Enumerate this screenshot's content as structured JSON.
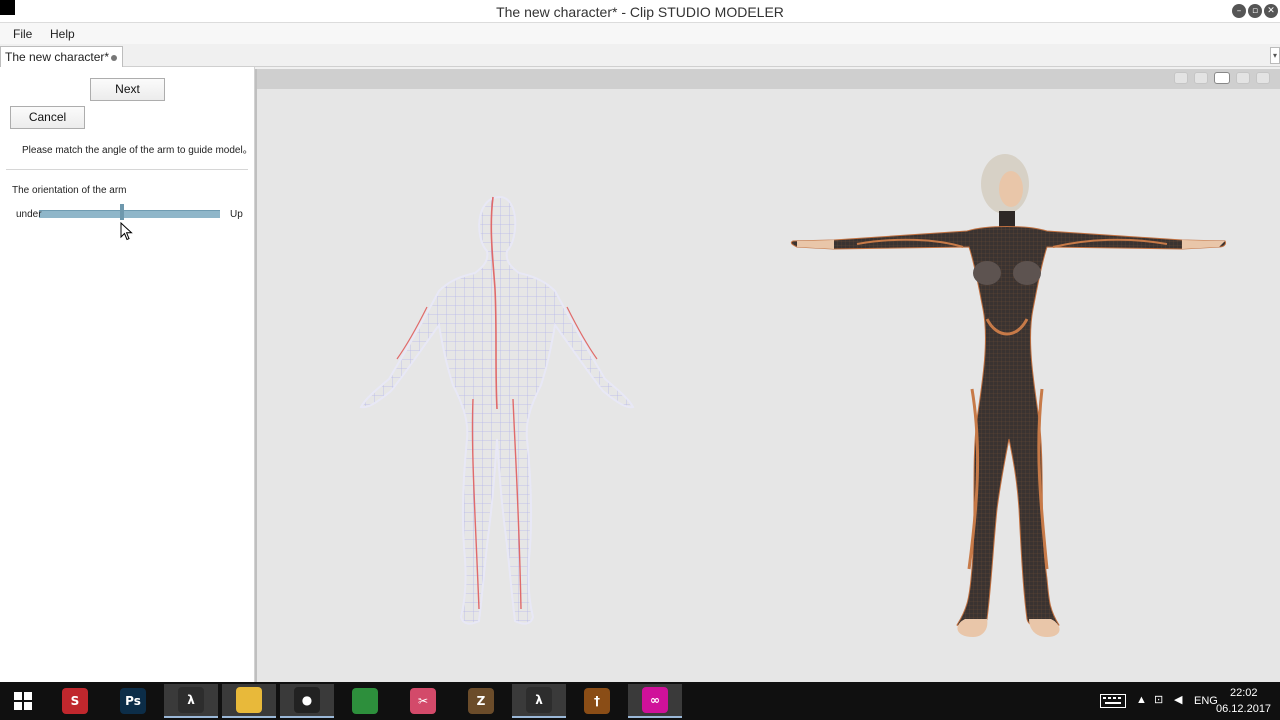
{
  "window": {
    "title": "The new character* - Clip STUDIO MODELER"
  },
  "menu": [
    "File",
    "Help"
  ],
  "document_tab": {
    "label": "The new character*"
  },
  "panel": {
    "next_label": "Next",
    "cancel_label": "Cancel",
    "instruction": "Please match the angle of the arm to guide model。",
    "section_label": "The orientation of the arm",
    "slider": {
      "min_label": "under",
      "max_label": "Up",
      "value_fraction": 0.46
    }
  },
  "taskbar": {
    "apps": [
      {
        "name": "sketchup-icon",
        "glyph": "S",
        "color": "#c0272d"
      },
      {
        "name": "photoshop-icon",
        "glyph": "Ps",
        "color": "#0c2d48"
      },
      {
        "name": "clip-studio-icon",
        "glyph": "λ",
        "color": "#2d2d2d"
      },
      {
        "name": "file-explorer-icon",
        "glyph": "",
        "color": "#e8b93a"
      },
      {
        "name": "obs-icon",
        "glyph": "●",
        "color": "#222"
      },
      {
        "name": "chrome-icon",
        "glyph": "",
        "color": "#2d8f3c"
      },
      {
        "name": "snipping-tool-icon",
        "glyph": "✂",
        "color": "#d34a6a"
      },
      {
        "name": "zbrush-icon",
        "glyph": "Z",
        "color": "#6b4c2a"
      },
      {
        "name": "clip-studio-modeler-icon",
        "glyph": "λ",
        "color": "#2d2d2d"
      },
      {
        "name": "daz-studio-icon",
        "glyph": "†",
        "color": "#8a4d16"
      },
      {
        "name": "app-pink-icon",
        "glyph": "∞",
        "color": "#d0119a"
      }
    ],
    "language": "ENG",
    "time": "22:02",
    "date": "06.12.2017"
  }
}
